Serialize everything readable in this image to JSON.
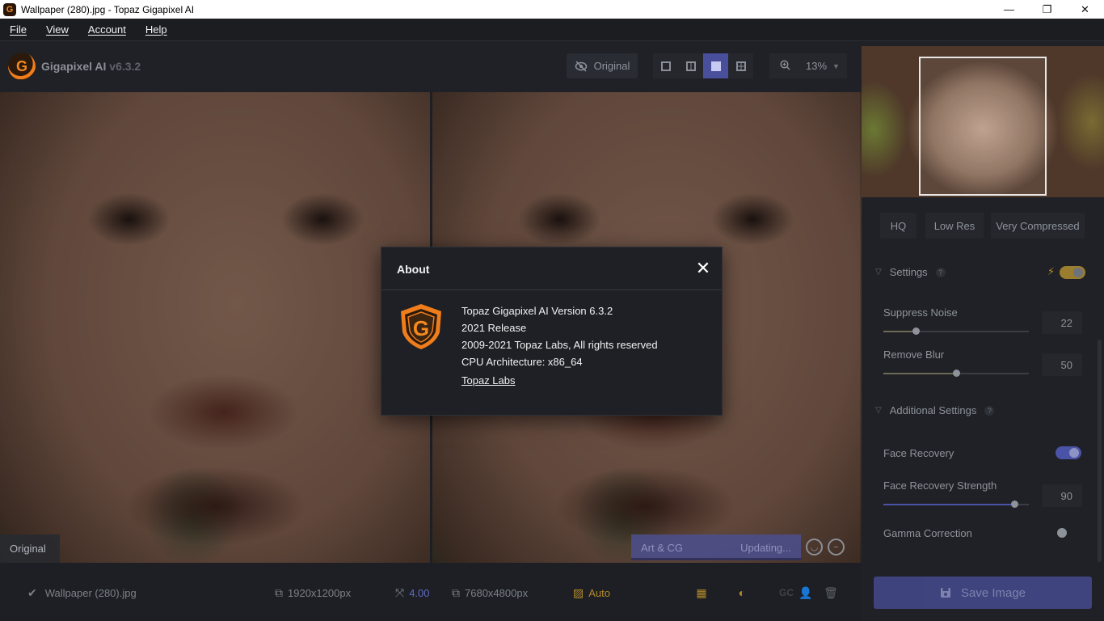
{
  "window": {
    "title": "Wallpaper (280).jpg - Topaz Gigapixel AI",
    "app_icon_letter": "G",
    "minimize": "—",
    "maximize": "❐",
    "close": "✕"
  },
  "menu": [
    "File",
    "View",
    "Account",
    "Help"
  ],
  "brand": {
    "name": "Gigapixel AI",
    "version": "v6.3.2",
    "logo_letter": "G"
  },
  "toolbar": {
    "original_label": "Original",
    "zoom_value": "13%"
  },
  "panes": {
    "left_label": "Original"
  },
  "model_bar": {
    "name": "Art & CG",
    "status": "Updating..."
  },
  "presets": [
    "HQ",
    "Low Res",
    "Very Compressed"
  ],
  "settings": {
    "header": "Settings",
    "suppress_noise": {
      "label": "Suppress Noise",
      "value": "22",
      "level": 0.22
    },
    "remove_blur": {
      "label": "Remove Blur",
      "value": "50",
      "level": 0.5
    }
  },
  "additional": {
    "header": "Additional Settings",
    "face_recovery": {
      "label": "Face Recovery",
      "on": true
    },
    "face_recovery_strength": {
      "label": "Face Recovery Strength",
      "value": "90",
      "level": 0.9
    },
    "gamma_correction": {
      "label": "Gamma Correction",
      "on": false
    }
  },
  "status": {
    "filename": "Wallpaper (280).jpg",
    "input_size": "1920x1200px",
    "scale": "4.00",
    "output_size": "7680x4800px",
    "mode": "Auto",
    "gc_label": "GC"
  },
  "save_label": "Save Image",
  "about": {
    "title": "About",
    "lines": [
      "Topaz Gigapixel AI Version 6.3.2",
      "2021 Release",
      "2009-2021 Topaz Labs, All rights reserved",
      "CPU Architecture: x86_64"
    ],
    "link": "Topaz Labs",
    "close_glyph": "✕",
    "logo_letter": "G"
  },
  "colors": {
    "accent": "#4a4f9c",
    "brand_orange": "#f07d1b",
    "gold": "#9a7d2e"
  }
}
